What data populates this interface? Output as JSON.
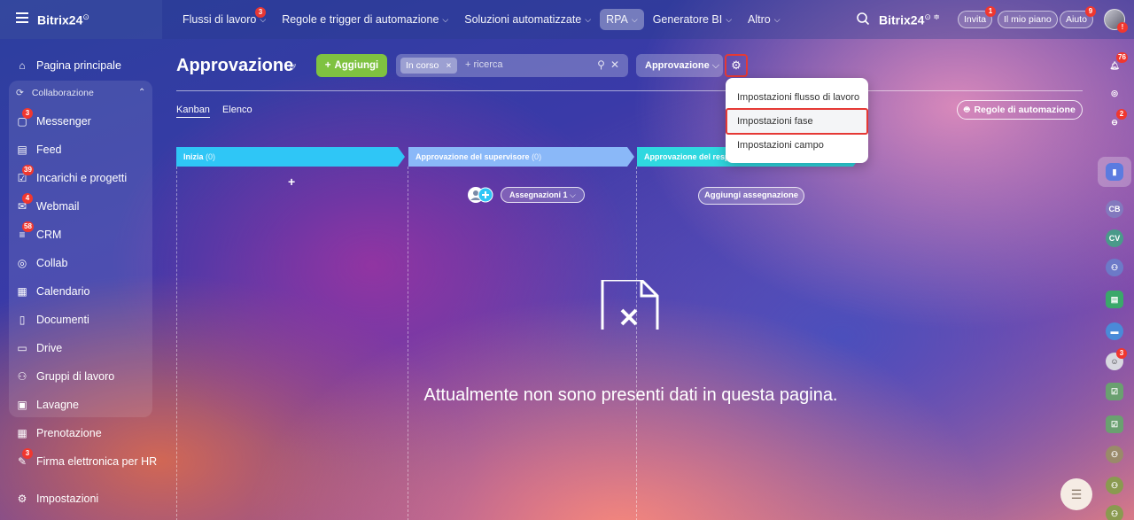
{
  "topbar": {
    "logo": "Bitrix24",
    "nav": [
      {
        "label": "Flussi di lavoro",
        "badge": "3"
      },
      {
        "label": "Regole e trigger di automazione"
      },
      {
        "label": "Soluzioni automatizzate"
      },
      {
        "label": "RPA"
      },
      {
        "label": "Generatore BI"
      },
      {
        "label": "Altro"
      }
    ],
    "invite": "Invita",
    "invite_badge": "1",
    "plan": "Il mio piano",
    "help": "Aiuto",
    "help_badge": "9"
  },
  "sidebar": {
    "home": "Pagina principale",
    "collab_header": "Collaborazione",
    "items": [
      {
        "label": "Messenger",
        "icon": "chat-icon",
        "badge": "3"
      },
      {
        "label": "Feed",
        "icon": "feed-icon"
      },
      {
        "label": "Incarichi e progetti",
        "icon": "task-icon",
        "badge": "39"
      },
      {
        "label": "Webmail",
        "icon": "mail-icon",
        "badge": "4"
      },
      {
        "label": "CRM",
        "icon": "crm-icon",
        "badge": "58"
      },
      {
        "label": "Collab",
        "icon": "collab-icon"
      },
      {
        "label": "Calendario",
        "icon": "calendar-icon"
      },
      {
        "label": "Documenti",
        "icon": "document-icon"
      },
      {
        "label": "Drive",
        "icon": "drive-icon"
      },
      {
        "label": "Gruppi di lavoro",
        "icon": "groups-icon"
      },
      {
        "label": "Lavagne",
        "icon": "board-icon"
      }
    ],
    "extra": [
      {
        "label": "Prenotazione",
        "icon": "booking-icon"
      },
      {
        "label": "Firma elettronica per HR",
        "icon": "signature-icon",
        "badge": "3"
      }
    ],
    "settings": "Impostazioni"
  },
  "header": {
    "title": "Approvazione",
    "add_button": "Aggiungi",
    "filter_chip": "In corso",
    "search_placeholder": "+ ricerca",
    "process_dropdown": "Approvazione"
  },
  "tabs": {
    "kanban": "Kanban",
    "list": "Elenco"
  },
  "rules_button": "Regole di automazione",
  "menu": {
    "items": [
      "Impostazioni flusso di lavoro",
      "Impostazioni fase",
      "Impostazioni campo"
    ]
  },
  "stages": [
    {
      "name": "Inizia",
      "count": "(0)",
      "color": "#2fc6f6"
    },
    {
      "name": "Approvazione del supervisore",
      "count": "(0)",
      "color": "#8ab8f8"
    },
    {
      "name": "Approvazione del resp",
      "count": "",
      "color": "#2fd8e0"
    }
  ],
  "kanban": {
    "assign_pill": "Assegnazioni  1",
    "add_assign": "Aggiungi assegnazione"
  },
  "empty_state": "Attualmente non sono presenti dati in questa pagina.",
  "rail": {
    "notif_badge": "76",
    "chat_badge": "2",
    "user_badge": "3",
    "cb": "CB",
    "cv": "CV"
  }
}
